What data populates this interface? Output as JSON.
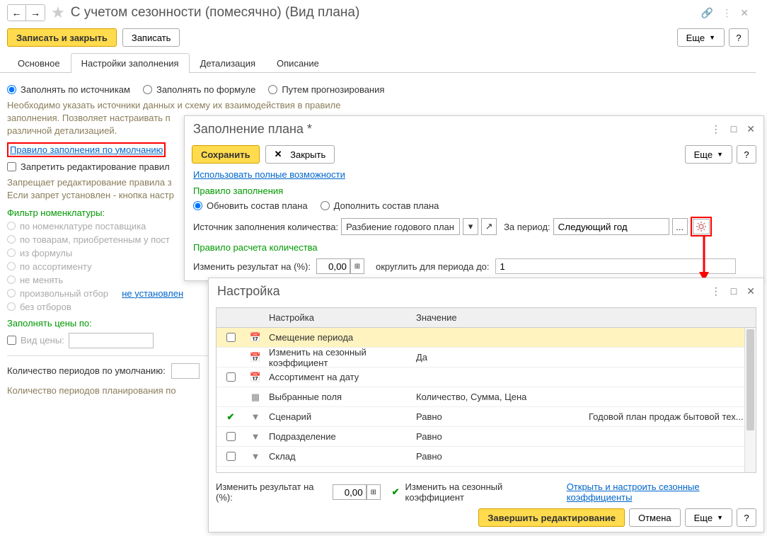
{
  "main": {
    "title": "С учетом сезонности (помесячно) (Вид плана)",
    "btn_save_close": "Записать и закрыть",
    "btn_save": "Записать",
    "btn_more": "Еще",
    "tabs": [
      "Основное",
      "Настройки заполнения",
      "Детализация",
      "Описание"
    ],
    "radios": [
      "Заполнять по источникам",
      "Заполнять по формуле",
      "Путем прогнозирования"
    ],
    "hint1": "Необходимо указать источники данных и схему их взаимодействия в правиле заполнения. Позволяет настраивать п",
    "hint1b": "различной детализацией.",
    "default_rule_link": "Правило заполнения по умолчанию",
    "forbid_edit": "Запретить редактирование правил",
    "forbid_hint1": "Запрещает редактирование правила з",
    "forbid_hint2": "Если запрет установлен - кнопка настр",
    "filter_label": "Фильтр номенклатуры:",
    "filter_opts": [
      "по номенклатуре поставщика",
      "по товарам, приобретенным у пост",
      "из формулы",
      "по ассортименту",
      "не менять",
      "произвольный отбор",
      "без отборов"
    ],
    "not_set": "не установлен",
    "fill_prices": "Заполнять цены по:",
    "price_type": "Вид цены:",
    "periods_label": "Количество периодов по умолчанию:",
    "periods_hint": "Количество периодов планирования по"
  },
  "dlg2": {
    "title": "Заполнение плана *",
    "btn_save": "Сохранить",
    "btn_close": "Закрыть",
    "btn_more": "Еще",
    "use_full": "Использовать полные возможности",
    "rule_label": "Правило заполнения",
    "rule_opts": [
      "Обновить состав плана",
      "Дополнить состав плана"
    ],
    "src_label": "Источник заполнения количества:",
    "src_value": "Разбиение годового план",
    "period_label": "За период:",
    "period_value": "Следующий год",
    "calc_rule": "Правило расчета количества",
    "change_result": "Изменить результат на (%):",
    "change_val": "0,00",
    "round_label": "округлить для периода до:",
    "round_val": "1"
  },
  "dlg3": {
    "title": "Настройка",
    "col_name": "Настройка",
    "col_val": "Значение",
    "rows": [
      {
        "chk": false,
        "name": "Смещение периода",
        "val": "",
        "val2": "",
        "hl": true,
        "icon": "calendar"
      },
      {
        "chk": null,
        "name": "Изменить на сезонный коэффициент",
        "val": "Да",
        "val2": "",
        "icon": "calendar"
      },
      {
        "chk": false,
        "name": "Ассортимент на дату",
        "val": "",
        "val2": "",
        "icon": "calendar"
      },
      {
        "chk": null,
        "name": "Выбранные поля",
        "val": "Количество, Сумма, Цена",
        "val2": "",
        "icon": "fields"
      },
      {
        "chk": true,
        "name": "Сценарий",
        "val": "Равно",
        "val2": "Годовой план продаж бытовой тех...",
        "icon": "filter"
      },
      {
        "chk": false,
        "name": "Подразделение",
        "val": "Равно",
        "val2": "",
        "icon": "filter"
      },
      {
        "chk": false,
        "name": "Склад",
        "val": "Равно",
        "val2": "",
        "icon": "filter"
      }
    ],
    "change_result": "Изменить результат на (%):",
    "change_val": "0,00",
    "seasonal": "Изменить на сезонный коэффициент",
    "open_link": "Открыть и настроить сезонные коэффициенты",
    "btn_finish": "Завершить редактирование",
    "btn_cancel": "Отмена",
    "btn_more": "Еще"
  }
}
